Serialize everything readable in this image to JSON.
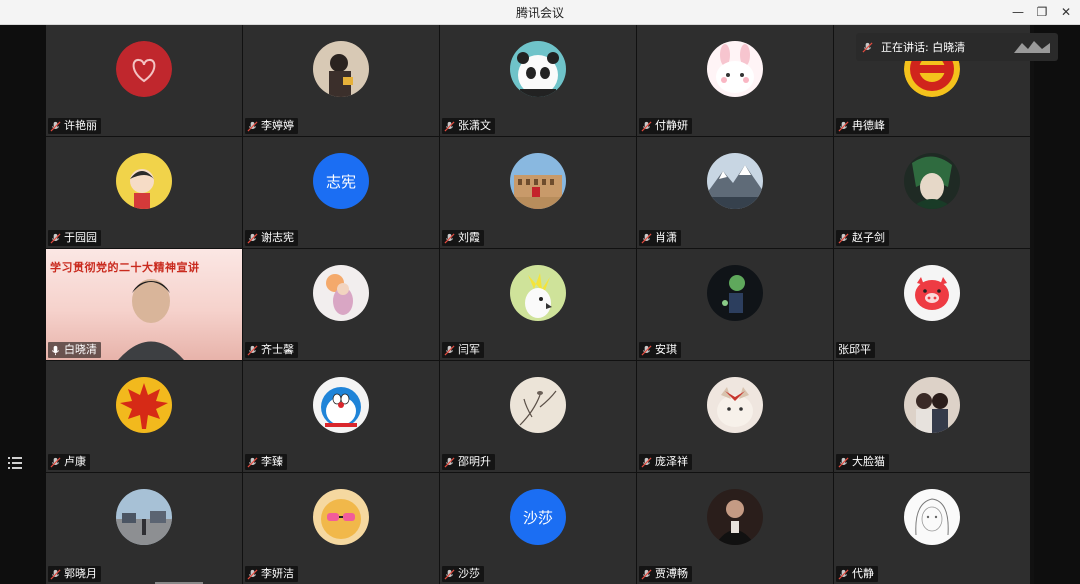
{
  "window": {
    "title": "腾讯会议"
  },
  "speaking": {
    "text": "正在讲话: 白晓清"
  },
  "video_tile": {
    "banner": "学习贯彻党的二十大精神宣讲"
  },
  "participants": [
    {
      "name": "许艳丽",
      "avatar": "heart-red",
      "muted": true
    },
    {
      "name": "李婷婷",
      "avatar": "girl-photo",
      "muted": true
    },
    {
      "name": "张潇文",
      "avatar": "panda",
      "muted": true
    },
    {
      "name": "付静妍",
      "avatar": "bunny",
      "muted": true
    },
    {
      "name": "冉德峰",
      "avatar": "ring-red",
      "muted": true
    },
    {
      "name": "于园园",
      "avatar": "cartoon-girl",
      "muted": true
    },
    {
      "name": "谢志宪",
      "avatar": "text",
      "avatar_text": "志宪",
      "muted": true
    },
    {
      "name": "刘霞",
      "avatar": "colosseum",
      "muted": true
    },
    {
      "name": "肖潇",
      "avatar": "snow-mountain",
      "muted": true
    },
    {
      "name": "赵子剑",
      "avatar": "anime-green",
      "muted": true
    },
    {
      "name": "白晓清",
      "avatar": "video",
      "muted": false
    },
    {
      "name": "齐士馨",
      "avatar": "pink-figure",
      "muted": true
    },
    {
      "name": "闫军",
      "avatar": "cockatoo",
      "muted": true
    },
    {
      "name": "安琪",
      "avatar": "dark-figure",
      "muted": true
    },
    {
      "name": "张邱平",
      "avatar": "pink-pig",
      "muted": false
    },
    {
      "name": "卢康",
      "avatar": "maple-leaf",
      "muted": true
    },
    {
      "name": "李臻",
      "avatar": "doraemon",
      "muted": true
    },
    {
      "name": "邵明升",
      "avatar": "ink-branch",
      "muted": true
    },
    {
      "name": "庞泽祥",
      "avatar": "cat-ribbon",
      "muted": true
    },
    {
      "name": "大脸猫",
      "avatar": "couple-photo",
      "muted": true
    },
    {
      "name": "郭晓月",
      "avatar": "street-photo",
      "muted": true
    },
    {
      "name": "李妍洁",
      "avatar": "sunglasses",
      "muted": true
    },
    {
      "name": "沙莎",
      "avatar": "text",
      "avatar_text": "沙莎",
      "muted": true
    },
    {
      "name": "贾溥畅",
      "avatar": "man-dark",
      "muted": true
    },
    {
      "name": "代静",
      "avatar": "sketch-girl",
      "muted": true
    }
  ],
  "colors": {
    "tile": "#2e2e2e",
    "text_avatar": "#1b6ef3",
    "titlebar": "#f4f4f4"
  }
}
